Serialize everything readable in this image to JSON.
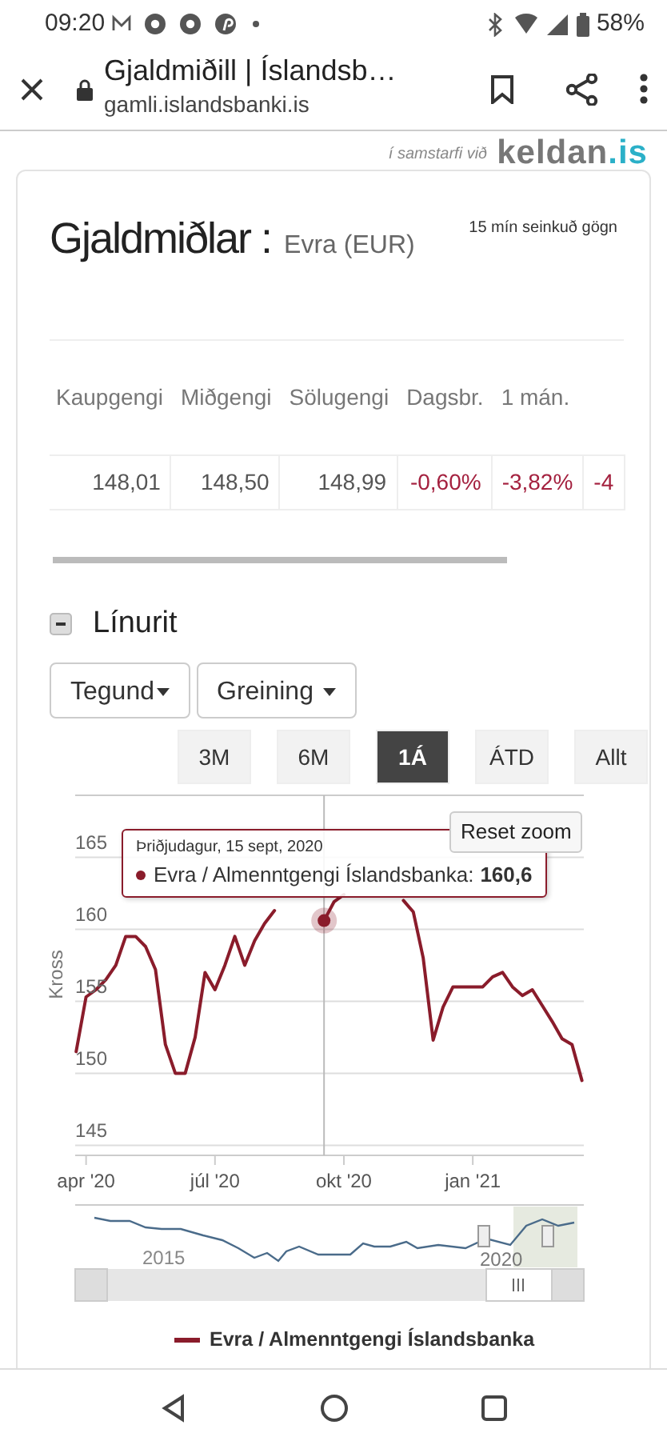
{
  "status_bar": {
    "time": "09:20",
    "battery": "58%"
  },
  "browser": {
    "title": "Gjaldmiðill | Íslandsb…",
    "url": "gamli.islandsbanki.is"
  },
  "partner": {
    "label": "í samstarfi við",
    "logo": "keldan",
    "logo_suffix": ".is"
  },
  "header": {
    "title": "Gjaldmiðlar :",
    "subtitle": "Evra (EUR)",
    "note": "15 mín seinkuð gögn"
  },
  "table": {
    "columns": [
      "Kaupgengi",
      "Miðgengi",
      "Sölugengi",
      "Dagsbr.",
      "1 mán."
    ],
    "rows": [
      {
        "cells": [
          {
            "text": "148,01",
            "negative": false
          },
          {
            "text": "148,50",
            "negative": false
          },
          {
            "text": "148,99",
            "negative": false
          },
          {
            "text": "-0,60%",
            "negative": true
          },
          {
            "text": "-3,82%",
            "negative": true
          },
          {
            "text": "-4",
            "negative": true
          }
        ]
      }
    ]
  },
  "chart_section": {
    "title": "Línurit",
    "expanded": true,
    "dropdowns": [
      "Tegund",
      "Greining"
    ],
    "ranges": [
      {
        "label": "3M",
        "selected": false
      },
      {
        "label": "6M",
        "selected": false
      },
      {
        "label": "1Á",
        "selected": true
      },
      {
        "label": "ÁTD",
        "selected": false
      },
      {
        "label": "Allt",
        "selected": false
      }
    ],
    "reset_zoom": "Reset zoom",
    "chart_data": {
      "type": "line",
      "ylabel": "Kross",
      "categories": [
        null,
        "apr '20",
        null,
        null,
        null,
        null,
        null,
        null,
        null,
        null,
        null,
        null,
        null,
        null,
        "júl '20",
        null,
        null,
        null,
        null,
        null,
        null,
        null,
        null,
        null,
        null,
        null,
        null,
        "okt '20",
        null,
        null,
        null,
        null,
        null,
        null,
        null,
        null,
        null,
        null,
        null,
        null,
        "jan '21",
        null,
        null,
        null,
        null,
        null,
        null,
        null,
        null,
        null,
        null,
        null
      ],
      "series": [
        {
          "name": "Evra / Almenntgengi Íslandsbanka",
          "color": "#8a1c2b",
          "values": [
            151.5,
            155.3,
            155.8,
            156.5,
            157.5,
            159.5,
            159.5,
            158.8,
            157.2,
            152,
            150,
            150,
            152.5,
            157,
            155.8,
            157.5,
            159.5,
            157.5,
            159.2,
            160.4,
            161.3,
            null,
            null,
            null,
            null,
            160.6,
            161.9,
            162.4,
            null,
            null,
            null,
            null,
            null,
            162,
            161.2,
            158,
            152.3,
            154.6,
            156,
            156,
            156,
            156,
            156.7,
            157,
            156,
            155.4,
            155.8,
            154.7,
            153.6,
            152.4,
            152,
            149.5
          ]
        }
      ],
      "ylim": [
        144.3,
        169.3
      ],
      "yticks": [
        145,
        150,
        155,
        160,
        165
      ],
      "grid": true
    },
    "tooltip": {
      "date": "Þriðjudagur, 15 sept, 2020",
      "series": "Evra / Almenntgengi Íslandsbanka:",
      "value": "160,6"
    },
    "navigator": {
      "labels": [
        "2015",
        "2020"
      ]
    }
  }
}
